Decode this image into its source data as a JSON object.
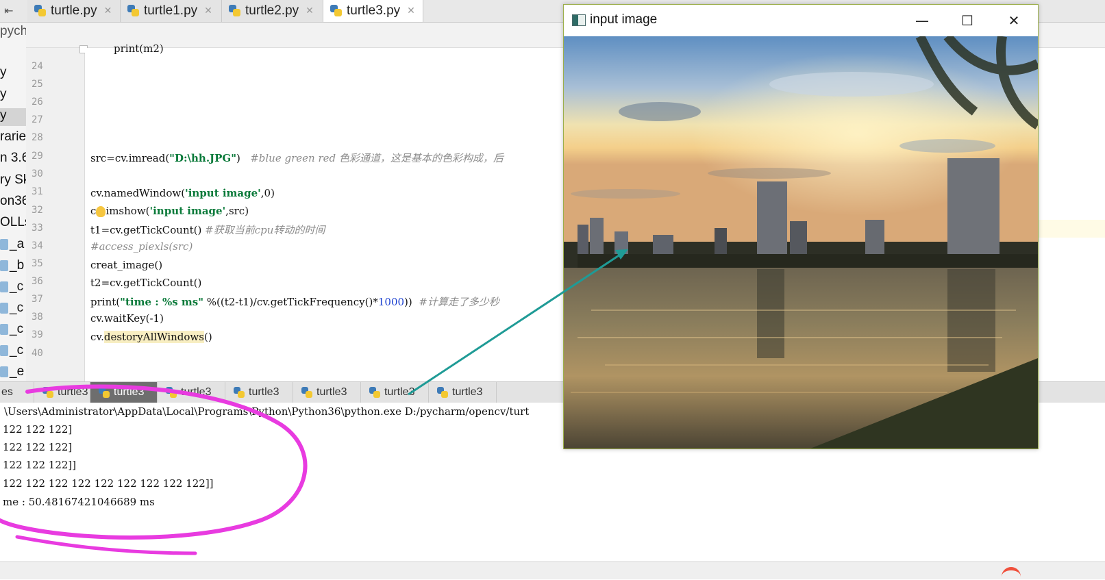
{
  "editor_tabs": [
    {
      "label": "turtle.py"
    },
    {
      "label": "turtle1.py"
    },
    {
      "label": "turtle2.py"
    },
    {
      "label": "turtle3.py"
    }
  ],
  "project_panel": {
    "header": "pych",
    "items": [
      "y",
      "y",
      "y",
      "raries",
      "n 3.6",
      "ry Sk",
      "on36",
      "OLLs",
      "_a",
      "_b",
      "_c",
      "_c",
      "_c",
      "_c",
      "_e"
    ]
  },
  "code": {
    "top_partial": "print(m2)",
    "line_numbers": [
      "24",
      "25",
      "26",
      "27",
      "28",
      "29",
      "30",
      "31",
      "32",
      "33",
      "34",
      "35",
      "36",
      "37",
      "38",
      "39",
      "40"
    ],
    "line29_code": "src=cv.imread(",
    "line29_str": "\"D:\\hh.JPG\"",
    "line29_close": ")",
    "line29_comment": "#blue green red 色彩通道，这是基本的色彩构成，后",
    "line31_a": "cv.namedWindow(",
    "line31_str": "'input image'",
    "line31_b": ",0)",
    "line32_a": "c",
    "line32_b": "imshow(",
    "line32_str": "'input image'",
    "line32_c": ",src)",
    "line33_code": "t1=cv.getTickCount()",
    "line33_comment": "#获取当前cpu转动的时间",
    "line34_comment": "#access_piexls(src)",
    "line35_code": "creat_image()",
    "line36_code": "t2=cv.getTickCount()",
    "line37_a": "print(",
    "line37_str": "\"time : %s ms\"",
    "line37_b": " %((t2-t1)/cv.getTickFrequency()*",
    "line37_num": "1000",
    "line37_c": "))",
    "line37_comment": "#计算走了多少秒",
    "line38_code": "cv.waitKey(-1)",
    "line39_a": "cv.",
    "line39_b": "destoryAllWindows",
    "line39_c": "()"
  },
  "run_tabs": [
    "es",
    "turtle3",
    "turtle3",
    "turtle3",
    "turtle3",
    "turtle3",
    "turtle3",
    "turtle3"
  ],
  "console": {
    "lines": [
      "\\Users\\Administrator\\AppData\\Local\\Programs\\Python\\Python36\\python.exe D:/pycharm/opencv/turt",
      "122 122 122]",
      "122 122 122]",
      "122 122 122]]",
      "122 122 122 122 122 122 122 122 122]]",
      "me : 50.48167421046689 ms"
    ]
  },
  "cv_window": {
    "title": "input image",
    "minimize": "—",
    "maximize": "☐",
    "close": "✕"
  },
  "colors": {
    "annotation": "#e83be0",
    "arrow": "#1f9b96",
    "window_border": "#9caf4a"
  }
}
